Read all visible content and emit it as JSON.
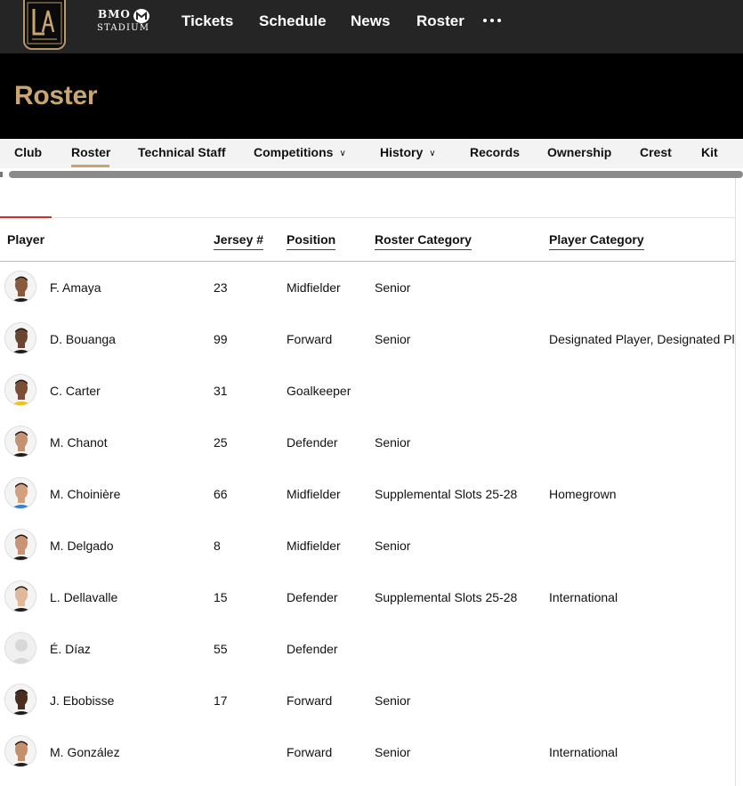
{
  "topnav": {
    "crest_text": "LA",
    "stadium_bmo": "BMO",
    "stadium_name": "STADIUM",
    "links": [
      "Tickets",
      "Schedule",
      "News",
      "Roster"
    ]
  },
  "page": {
    "title": "Roster"
  },
  "subnav": {
    "items": [
      "Club",
      "Roster",
      "Technical Staff",
      "Competitions",
      "History",
      "Records",
      "Ownership",
      "Crest",
      "Kit"
    ],
    "active": "Roster"
  },
  "table": {
    "headers": [
      "Player",
      "Jersey #",
      "Position",
      "Roster Category",
      "Player Category"
    ],
    "rows": [
      {
        "name": "F. Amaya",
        "jersey": "23",
        "position": "Midfielder",
        "roster_category": "Senior",
        "player_category": ""
      },
      {
        "name": "D. Bouanga",
        "jersey": "99",
        "position": "Forward",
        "roster_category": "Senior",
        "player_category": "Designated Player, Designated Pl"
      },
      {
        "name": "C. Carter",
        "jersey": "31",
        "position": "Goalkeeper",
        "roster_category": "",
        "player_category": ""
      },
      {
        "name": "M. Chanot",
        "jersey": "25",
        "position": "Defender",
        "roster_category": "Senior",
        "player_category": ""
      },
      {
        "name": "M. Choinière",
        "jersey": "66",
        "position": "Midfielder",
        "roster_category": "Supplemental Slots 25-28",
        "player_category": "Homegrown"
      },
      {
        "name": "M. Delgado",
        "jersey": "8",
        "position": "Midfielder",
        "roster_category": "Senior",
        "player_category": ""
      },
      {
        "name": "L. Dellavalle",
        "jersey": "15",
        "position": "Defender",
        "roster_category": "Supplemental Slots 25-28",
        "player_category": "International"
      },
      {
        "name": "É. Díaz",
        "jersey": "55",
        "position": "Defender",
        "roster_category": "",
        "player_category": ""
      },
      {
        "name": "J. Ebobisse",
        "jersey": "17",
        "position": "Forward",
        "roster_category": "Senior",
        "player_category": ""
      },
      {
        "name": "M. González",
        "jersey": "",
        "position": "Forward",
        "roster_category": "Senior",
        "player_category": "International"
      }
    ]
  },
  "colors": {
    "gold": "#c9a572",
    "topbar": "#252525",
    "accent_red": "#d0302c"
  },
  "icons": {
    "more": "more-horizontal-icon",
    "dropdown": "chevron-down-icon",
    "avatar_placeholder": "user-silhouette-icon"
  }
}
